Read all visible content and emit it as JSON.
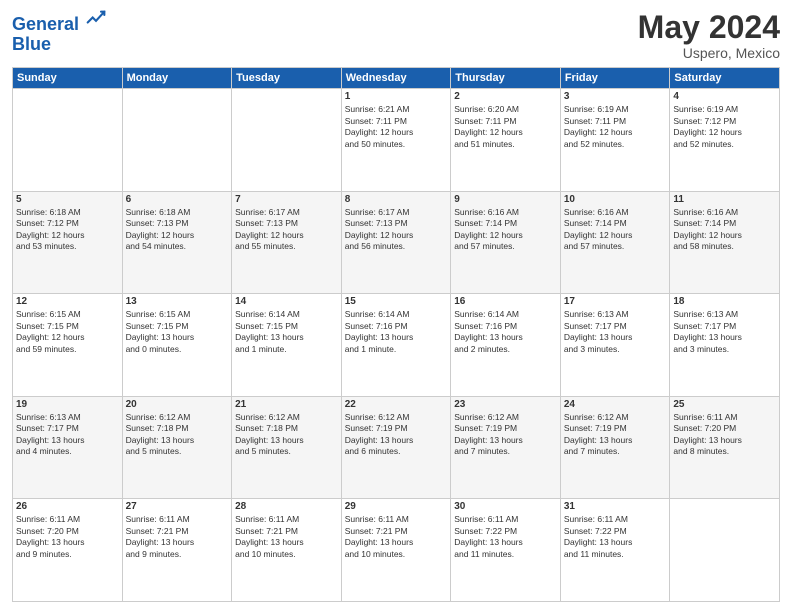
{
  "logo": {
    "line1": "General",
    "line2": "Blue"
  },
  "title": "May 2024",
  "location": "Uspero, Mexico",
  "weekdays": [
    "Sunday",
    "Monday",
    "Tuesday",
    "Wednesday",
    "Thursday",
    "Friday",
    "Saturday"
  ],
  "weeks": [
    [
      {
        "day": "",
        "info": ""
      },
      {
        "day": "",
        "info": ""
      },
      {
        "day": "",
        "info": ""
      },
      {
        "day": "1",
        "info": "Sunrise: 6:21 AM\nSunset: 7:11 PM\nDaylight: 12 hours\nand 50 minutes."
      },
      {
        "day": "2",
        "info": "Sunrise: 6:20 AM\nSunset: 7:11 PM\nDaylight: 12 hours\nand 51 minutes."
      },
      {
        "day": "3",
        "info": "Sunrise: 6:19 AM\nSunset: 7:11 PM\nDaylight: 12 hours\nand 52 minutes."
      },
      {
        "day": "4",
        "info": "Sunrise: 6:19 AM\nSunset: 7:12 PM\nDaylight: 12 hours\nand 52 minutes."
      }
    ],
    [
      {
        "day": "5",
        "info": "Sunrise: 6:18 AM\nSunset: 7:12 PM\nDaylight: 12 hours\nand 53 minutes."
      },
      {
        "day": "6",
        "info": "Sunrise: 6:18 AM\nSunset: 7:13 PM\nDaylight: 12 hours\nand 54 minutes."
      },
      {
        "day": "7",
        "info": "Sunrise: 6:17 AM\nSunset: 7:13 PM\nDaylight: 12 hours\nand 55 minutes."
      },
      {
        "day": "8",
        "info": "Sunrise: 6:17 AM\nSunset: 7:13 PM\nDaylight: 12 hours\nand 56 minutes."
      },
      {
        "day": "9",
        "info": "Sunrise: 6:16 AM\nSunset: 7:14 PM\nDaylight: 12 hours\nand 57 minutes."
      },
      {
        "day": "10",
        "info": "Sunrise: 6:16 AM\nSunset: 7:14 PM\nDaylight: 12 hours\nand 57 minutes."
      },
      {
        "day": "11",
        "info": "Sunrise: 6:16 AM\nSunset: 7:14 PM\nDaylight: 12 hours\nand 58 minutes."
      }
    ],
    [
      {
        "day": "12",
        "info": "Sunrise: 6:15 AM\nSunset: 7:15 PM\nDaylight: 12 hours\nand 59 minutes."
      },
      {
        "day": "13",
        "info": "Sunrise: 6:15 AM\nSunset: 7:15 PM\nDaylight: 13 hours\nand 0 minutes."
      },
      {
        "day": "14",
        "info": "Sunrise: 6:14 AM\nSunset: 7:15 PM\nDaylight: 13 hours\nand 1 minute."
      },
      {
        "day": "15",
        "info": "Sunrise: 6:14 AM\nSunset: 7:16 PM\nDaylight: 13 hours\nand 1 minute."
      },
      {
        "day": "16",
        "info": "Sunrise: 6:14 AM\nSunset: 7:16 PM\nDaylight: 13 hours\nand 2 minutes."
      },
      {
        "day": "17",
        "info": "Sunrise: 6:13 AM\nSunset: 7:17 PM\nDaylight: 13 hours\nand 3 minutes."
      },
      {
        "day": "18",
        "info": "Sunrise: 6:13 AM\nSunset: 7:17 PM\nDaylight: 13 hours\nand 3 minutes."
      }
    ],
    [
      {
        "day": "19",
        "info": "Sunrise: 6:13 AM\nSunset: 7:17 PM\nDaylight: 13 hours\nand 4 minutes."
      },
      {
        "day": "20",
        "info": "Sunrise: 6:12 AM\nSunset: 7:18 PM\nDaylight: 13 hours\nand 5 minutes."
      },
      {
        "day": "21",
        "info": "Sunrise: 6:12 AM\nSunset: 7:18 PM\nDaylight: 13 hours\nand 5 minutes."
      },
      {
        "day": "22",
        "info": "Sunrise: 6:12 AM\nSunset: 7:19 PM\nDaylight: 13 hours\nand 6 minutes."
      },
      {
        "day": "23",
        "info": "Sunrise: 6:12 AM\nSunset: 7:19 PM\nDaylight: 13 hours\nand 7 minutes."
      },
      {
        "day": "24",
        "info": "Sunrise: 6:12 AM\nSunset: 7:19 PM\nDaylight: 13 hours\nand 7 minutes."
      },
      {
        "day": "25",
        "info": "Sunrise: 6:11 AM\nSunset: 7:20 PM\nDaylight: 13 hours\nand 8 minutes."
      }
    ],
    [
      {
        "day": "26",
        "info": "Sunrise: 6:11 AM\nSunset: 7:20 PM\nDaylight: 13 hours\nand 9 minutes."
      },
      {
        "day": "27",
        "info": "Sunrise: 6:11 AM\nSunset: 7:21 PM\nDaylight: 13 hours\nand 9 minutes."
      },
      {
        "day": "28",
        "info": "Sunrise: 6:11 AM\nSunset: 7:21 PM\nDaylight: 13 hours\nand 10 minutes."
      },
      {
        "day": "29",
        "info": "Sunrise: 6:11 AM\nSunset: 7:21 PM\nDaylight: 13 hours\nand 10 minutes."
      },
      {
        "day": "30",
        "info": "Sunrise: 6:11 AM\nSunset: 7:22 PM\nDaylight: 13 hours\nand 11 minutes."
      },
      {
        "day": "31",
        "info": "Sunrise: 6:11 AM\nSunset: 7:22 PM\nDaylight: 13 hours\nand 11 minutes."
      },
      {
        "day": "",
        "info": ""
      }
    ]
  ]
}
